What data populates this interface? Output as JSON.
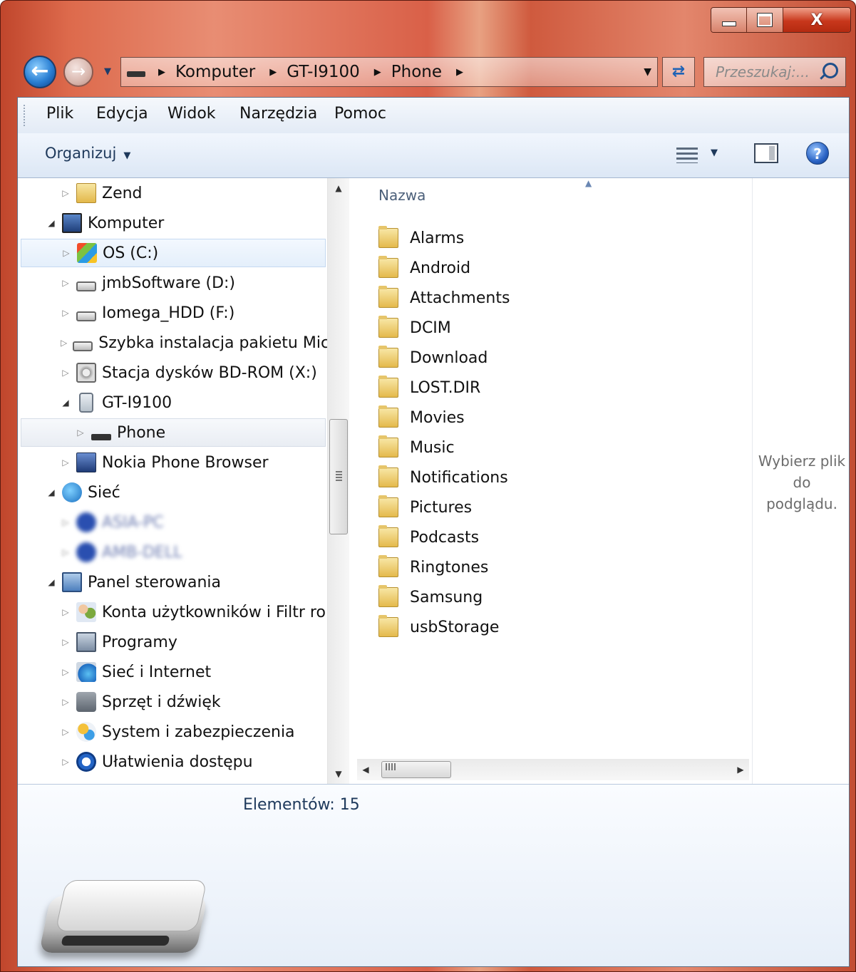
{
  "window": {
    "caption_buttons": {
      "minimize": "",
      "maximize": "",
      "close": "X"
    }
  },
  "address_bar": {
    "crumbs": [
      "Komputer",
      "GT-I9100",
      "Phone"
    ],
    "search_placeholder": "Przeszukaj:..."
  },
  "menu": {
    "items": [
      "Plik",
      "Edycja",
      "Widok",
      "Narzędzia",
      "Pomoc"
    ]
  },
  "command_bar": {
    "organize": "Organizuj"
  },
  "nav_tree": [
    {
      "label": "Zend",
      "icon": "folder-icon"
    },
    {
      "label": "Komputer",
      "icon": "computer-icon"
    },
    {
      "label": "OS (C:)",
      "icon": "os-drive-icon"
    },
    {
      "label": "jmbSoftware (D:)",
      "icon": "hard-drive-icon"
    },
    {
      "label": "Iomega_HDD (F:)",
      "icon": "hard-drive-icon"
    },
    {
      "label": "Szybka instalacja pakietu Mic",
      "icon": "hard-drive-icon"
    },
    {
      "label": "Stacja dysków BD-ROM (X:)",
      "icon": "optical-drive-icon"
    },
    {
      "label": "GT-I9100",
      "icon": "phone-device-icon"
    },
    {
      "label": "Phone",
      "icon": "phone-storage-icon"
    },
    {
      "label": "Nokia Phone Browser",
      "icon": "nokia-browser-icon"
    },
    {
      "label": "Sieć",
      "icon": "network-icon"
    },
    {
      "label": "ASIA-PC",
      "icon": "network-computer-icon"
    },
    {
      "label": "AMB-DELL",
      "icon": "network-computer-icon"
    },
    {
      "label": "Panel sterowania",
      "icon": "control-panel-icon"
    },
    {
      "label": "Konta użytkowników i Filtr ro",
      "icon": "user-accounts-icon"
    },
    {
      "label": "Programy",
      "icon": "programs-icon"
    },
    {
      "label": "Sieć i Internet",
      "icon": "network-internet-icon"
    },
    {
      "label": "Sprzęt i dźwięk",
      "icon": "hardware-sound-icon"
    },
    {
      "label": "System i zabezpieczenia",
      "icon": "system-security-icon"
    },
    {
      "label": "Ułatwienia dostępu",
      "icon": "accessibility-icon"
    }
  ],
  "file_list": {
    "column_header": "Nazwa",
    "items": [
      "Alarms",
      "Android",
      "Attachments",
      "DCIM",
      "Download",
      "LOST.DIR",
      "Movies",
      "Music",
      "Notifications",
      "Pictures",
      "Podcasts",
      "Ringtones",
      "Samsung",
      "usbStorage"
    ]
  },
  "preview_pane": {
    "lines": [
      "Wybierz plik",
      "do",
      "podglądu."
    ]
  },
  "details_pane": {
    "item_count": "Elementów: 15",
    "icon": "removable-drive-icon"
  }
}
